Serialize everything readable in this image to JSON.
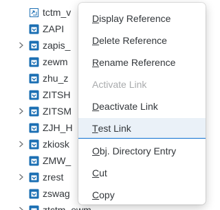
{
  "tree": {
    "items": [
      {
        "label": "tctm_v",
        "icon": "document-reference-icon",
        "expandable": false
      },
      {
        "label": "ZAPI",
        "icon": "package-icon",
        "expandable": false
      },
      {
        "label": "zapis_",
        "icon": "package-icon",
        "expandable": true
      },
      {
        "label": "zewm",
        "icon": "package-icon",
        "expandable": false
      },
      {
        "label": "zhu_z",
        "icon": "package-icon",
        "expandable": false
      },
      {
        "label": "ZITSH",
        "icon": "package-icon",
        "expandable": false
      },
      {
        "label": "ZITSM",
        "icon": "package-icon",
        "expandable": true
      },
      {
        "label": "ZJH_H",
        "icon": "package-icon",
        "expandable": false
      },
      {
        "label": "zkiosk",
        "icon": "package-icon",
        "expandable": true
      },
      {
        "label": "ZMW_",
        "icon": "package-icon",
        "expandable": false
      },
      {
        "label": "zrest",
        "icon": "package-icon",
        "expandable": true
      },
      {
        "label": "zswag",
        "icon": "package-icon",
        "expandable": false
      },
      {
        "label": "ztctm_ewm",
        "icon": "package-icon",
        "expandable": true
      }
    ]
  },
  "context_menu": {
    "items": [
      {
        "pre": "",
        "mnemonic": "D",
        "post": "isplay Reference",
        "disabled": false
      },
      {
        "pre": "",
        "mnemonic": "D",
        "post": "elete Reference",
        "disabled": false
      },
      {
        "pre": "",
        "mnemonic": "R",
        "post": "ename Reference",
        "disabled": false
      },
      {
        "pre": "Activate Link",
        "mnemonic": "",
        "post": "",
        "disabled": true
      },
      {
        "pre": "",
        "mnemonic": "D",
        "post": "eactivate Link",
        "disabled": false
      },
      {
        "pre": "",
        "mnemonic": "T",
        "post": "est Link",
        "disabled": false,
        "hovered": true
      },
      {
        "pre": "",
        "mnemonic": "O",
        "post": "bj. Directory Entry",
        "disabled": false
      },
      {
        "pre": "",
        "mnemonic": "C",
        "post": "ut",
        "disabled": false
      },
      {
        "pre": "",
        "mnemonic": "C",
        "post": "opy",
        "disabled": false
      }
    ]
  },
  "colors": {
    "package_icon": "#1b6fb3",
    "selection_separator": "#0a6ed1",
    "hover_background": "#eaf1f8",
    "disabled_text": "#a9abad"
  }
}
